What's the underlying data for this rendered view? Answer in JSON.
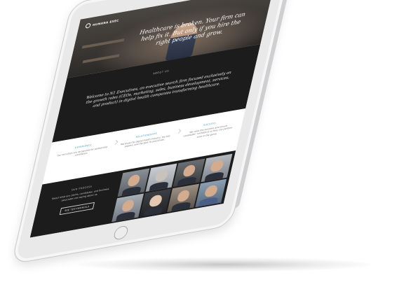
{
  "site": {
    "logo_text": "HUMANA EXEC",
    "hero_headline": "Healthcare is broken. Your firm can help fix it. But only if you hire the right people and grow.",
    "about_label": "ABOUT US",
    "about_text": "Welcome to N1 Executives, an executive search firm focused exclusively on the growth roles (CEOs, marketing, sales, business development, services, and product) in digital health companies transforming healthcare.",
    "cards": [
      {
        "title": "EXPERIENCE",
        "text": "Our recruiters are recognized for partnership excellence."
      },
      {
        "title": "RELATIONSHIPS",
        "text": "We know the digital health industry, the key players, and the best-fit executives."
      },
      {
        "title": "SUCCESS",
        "text": "We raise the outcome and ensure candidates' confidence so they can perform once in the game."
      }
    ],
    "bottom_label": "OUR PROCESS",
    "bottom_text": "Select what are clients, candidates, and business associates are saying about us.",
    "bottom_button": "SEE TESTIMONIALS"
  },
  "icons": {
    "menu": "hamburger-menu-icon",
    "logo": "logo-mark"
  },
  "colors": {
    "accent": "#3a8fc4",
    "dark_section": "#1c1c1c",
    "tablet_frame": "#e9e9ea"
  }
}
